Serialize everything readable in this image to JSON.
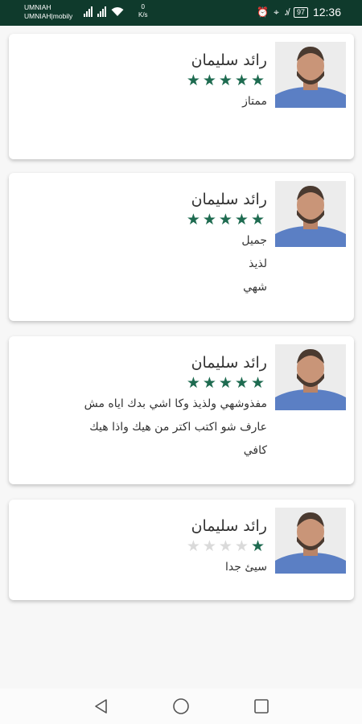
{
  "status_bar": {
    "carrier_line1": "UMNIAH",
    "carrier_line2": "UMNIAH|mobily",
    "speed_value": "0",
    "speed_unit": "K/s",
    "battery": "97",
    "time": "12:36"
  },
  "reviews": [
    {
      "name": "رائد سليمان",
      "rating": 5,
      "stars_filled": "★★★★★",
      "stars_empty": "",
      "lines": [
        "ممتاز"
      ]
    },
    {
      "name": "رائد سليمان",
      "rating": 5,
      "stars_filled": "★★★★★",
      "stars_empty": "",
      "lines": [
        "جميل",
        "لذيذ",
        "شهي"
      ]
    },
    {
      "name": "رائد سليمان",
      "rating": 5,
      "stars_filled": "★★★★★",
      "stars_empty": "",
      "lines": [
        "مفذوشهي ولذيذ وكا اشي بدك اياه مش",
        "عارف شو اكتب اكتر من هيك واذا هيك",
        "كافي"
      ]
    },
    {
      "name": "رائد سليمان",
      "rating": 1,
      "stars_filled": "★",
      "stars_empty": "★★★★",
      "lines": [
        "سيئ جدا"
      ]
    }
  ],
  "nav_bar": {
    "back_icon": "triangle-left",
    "home_icon": "circle",
    "recents_icon": "square"
  }
}
